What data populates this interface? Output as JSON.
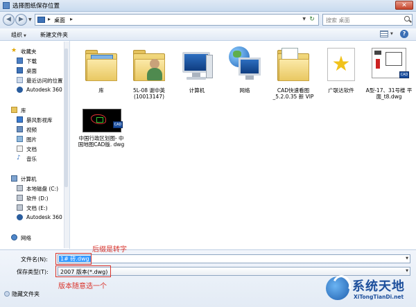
{
  "window": {
    "title": "选择图纸保存位置",
    "close_symbol": "✕"
  },
  "address": {
    "current": "桌面",
    "search_placeholder": "搜索 桌面"
  },
  "toolbar": {
    "organize": "组织",
    "new_folder": "新建文件夹",
    "help": "?"
  },
  "nav": {
    "items": [
      {
        "label": "收藏夹",
        "icon": "star-icon"
      },
      {
        "label": "下载",
        "icon": "download-icon"
      },
      {
        "label": "桌面",
        "icon": "desktop-icon"
      },
      {
        "label": "最近访问的位置",
        "icon": "recent-icon"
      },
      {
        "label": "Autodesk 360",
        "icon": "autodesk-icon"
      },
      {
        "label": "库",
        "icon": "library-icon"
      },
      {
        "label": "暴风影视库",
        "icon": "video-library-icon"
      },
      {
        "label": "视频",
        "icon": "video-icon"
      },
      {
        "label": "图片",
        "icon": "picture-icon"
      },
      {
        "label": "文档",
        "icon": "document-icon"
      },
      {
        "label": "音乐",
        "icon": "music-icon"
      },
      {
        "label": "计算机",
        "icon": "computer-icon"
      },
      {
        "label": "本地磁盘 (C:)",
        "icon": "drive-icon"
      },
      {
        "label": "软件 (D:)",
        "icon": "drive-icon"
      },
      {
        "label": "文档 (E:)",
        "icon": "drive-icon"
      },
      {
        "label": "Autodesk 360",
        "icon": "autodesk-icon"
      },
      {
        "label": "网络",
        "icon": "network-icon"
      }
    ]
  },
  "files": [
    {
      "label": "库",
      "icon": "library-folder-icon"
    },
    {
      "label": "5L-08 谢中英 (10013147)",
      "icon": "user-folder-icon"
    },
    {
      "label": "计算机",
      "icon": "computer-icon"
    },
    {
      "label": "网络",
      "icon": "network-icon"
    },
    {
      "label": "CAD快速看图 _5.2.0.35 新 VIP",
      "icon": "folder-icon"
    },
    {
      "label": "广联达软件",
      "icon": "star-shortcut-icon"
    },
    {
      "label": "A型-17、31号楼 平面_t8.dwg",
      "icon": "dwg-thumbnail-icon"
    },
    {
      "label": "中国行政区划图- 中国地图CAD版. dwg",
      "icon": "dwg-thumbnail-icon"
    }
  ],
  "save": {
    "filename_label": "文件名(N):",
    "filename_value": "1# 砖.dwg",
    "type_label": "保存类型(T):",
    "type_value": "2007 版本(*.dwg)",
    "hide_folders": "隐藏文件夹"
  },
  "annotations": {
    "suffix_note": "后缀是转字",
    "version_note": "版本随意选一个"
  },
  "watermark": {
    "name": "系统天地",
    "url": "XiTongTianDi.net"
  },
  "colors": {
    "annotation": "#d9332b",
    "selection": "#3399ff",
    "brand": "#1d4f9c"
  }
}
